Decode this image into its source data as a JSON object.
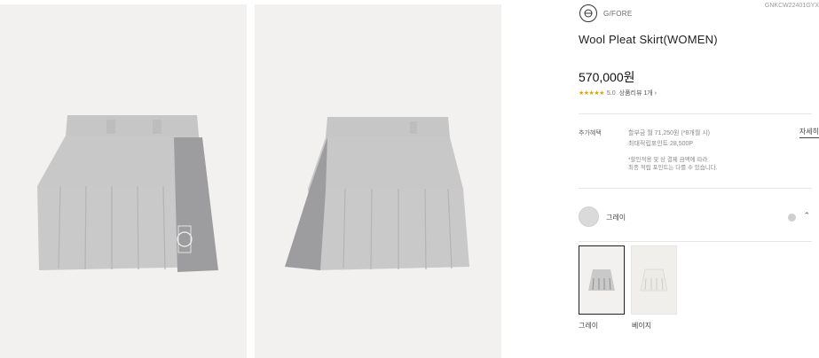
{
  "gallery": {
    "front_image_alt": "skirt-front-image",
    "back_image_alt": "skirt-back-image"
  },
  "product": {
    "brand": "G/FORE",
    "code": "GNKCW22401GYX",
    "title": "Wool Pleat Skirt(WOMEN)",
    "price": "570,000원",
    "rating": {
      "stars": "★★★★★",
      "value": "5.0",
      "review_link": "상품리뷰 1개 ›"
    }
  },
  "benefits": {
    "label": "추가혜택",
    "line1": "할부금 월 71,250원 (*8개월 시)",
    "line2": "최대적립포인트 28,500P",
    "note1": "*할인적용 및 상 결제 금액에 따라",
    "note2": "최종 적립 포인트는 다를 수 있습니다.",
    "detail_link": "자세히"
  },
  "color_selector": {
    "selected_label": "그레이",
    "chevron": "⌃",
    "options": [
      {
        "label": "그레이",
        "selected": true
      },
      {
        "label": "베이지",
        "selected": false
      }
    ]
  },
  "colors": {
    "skirt_gray": "#c9c9c9",
    "skirt_dark": "#9d9d9f",
    "beige": "#ecebe6",
    "panel_bg": "#f2f1f0"
  }
}
